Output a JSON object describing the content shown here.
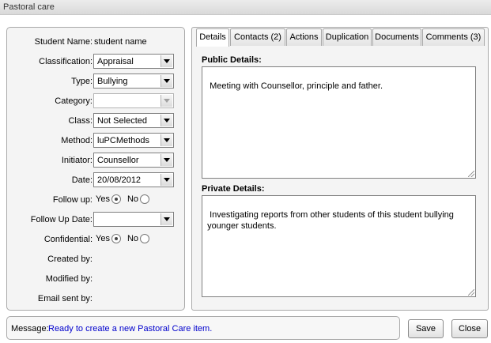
{
  "window": {
    "title": "Pastoral care"
  },
  "form": {
    "student_name_label": "Student Name:",
    "student_name_value": "student name",
    "classification_label": "Classification:",
    "classification_value": "Appraisal",
    "type_label": "Type:",
    "type_value": "Bullying",
    "category_label": "Category:",
    "category_value": "",
    "class_label": "Class:",
    "class_value": "Not Selected",
    "method_label": "Method:",
    "method_value": "luPCMethods",
    "initiator_label": "Initiator:",
    "initiator_value": "Counsellor",
    "date_label": "Date:",
    "date_value": "20/08/2012",
    "follow_up_label": "Follow up:",
    "follow_up_yes": "Yes",
    "follow_up_no": "No",
    "follow_up_selected": "Yes",
    "follow_up_date_label": "Follow Up Date:",
    "follow_up_date_value": "",
    "confidential_label": "Confidential:",
    "confidential_yes": "Yes",
    "confidential_no": "No",
    "confidential_selected": "Yes",
    "created_by_label": "Created by:",
    "modified_by_label": "Modified by:",
    "email_sent_by_label": "Email sent by:"
  },
  "tabs": [
    {
      "label": "Details",
      "active": true
    },
    {
      "label": "Contacts (2)",
      "active": false
    },
    {
      "label": "Actions",
      "active": false
    },
    {
      "label": "Duplication",
      "active": false
    },
    {
      "label": "Documents",
      "active": false
    },
    {
      "label": "Comments (3)",
      "active": false
    }
  ],
  "details": {
    "public_label": "Public Details:",
    "public_text": "Meeting with Counsellor, principle and father.",
    "private_label": "Private Details:",
    "private_text": "Investigating reports from other students of this student bullying\n younger students."
  },
  "footer": {
    "message_label": "Message:",
    "message_text": "Ready to create a new Pastoral Care item.",
    "save_label": "Save",
    "close_label": "Close"
  },
  "colors": {
    "message_text": "#0000cc",
    "panel_bg": "#f4f4f4"
  }
}
